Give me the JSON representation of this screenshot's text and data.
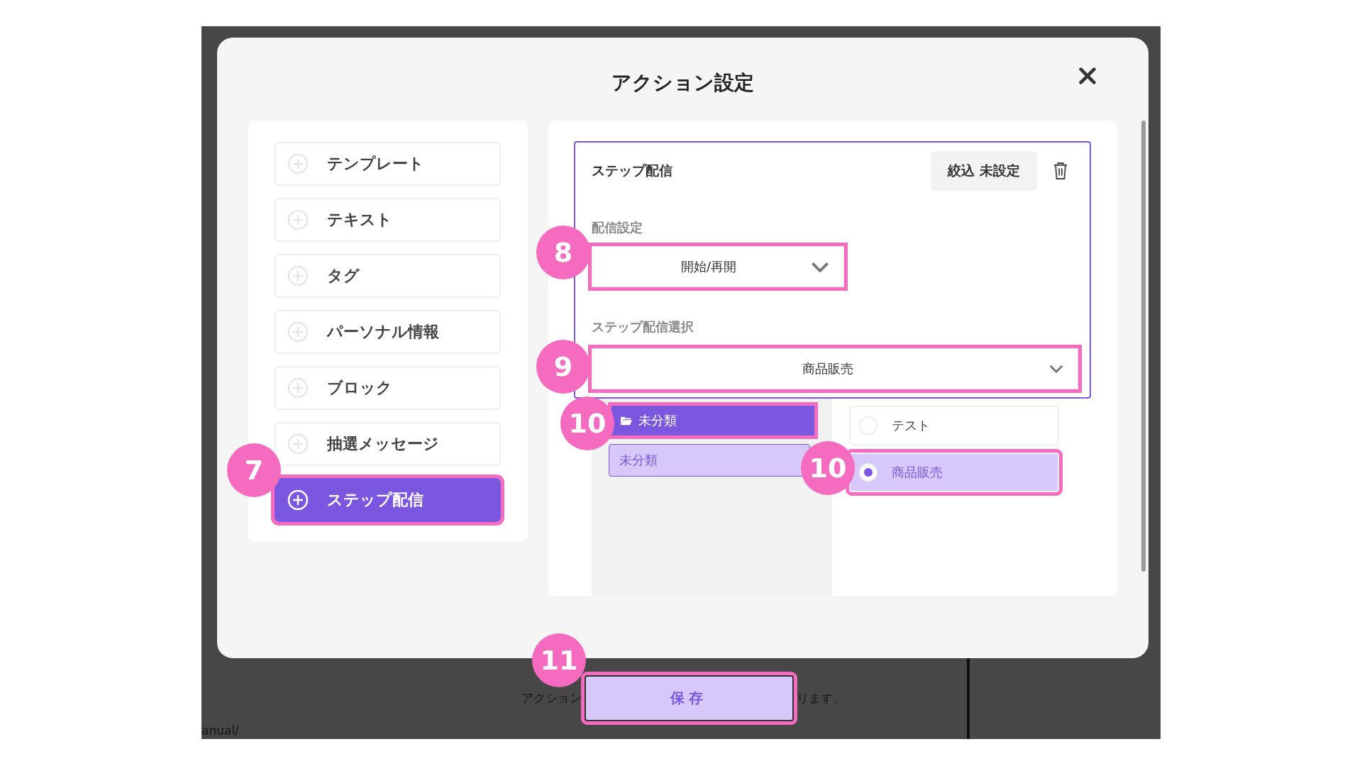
{
  "dialog": {
    "title": "アクション設定"
  },
  "action_types": [
    {
      "label": "テンプレート",
      "selected": false,
      "highlighted": false
    },
    {
      "label": "テキスト",
      "selected": false,
      "highlighted": false
    },
    {
      "label": "タグ",
      "selected": false,
      "highlighted": false
    },
    {
      "label": "パーソナル情報",
      "selected": false,
      "highlighted": false
    },
    {
      "label": "ブロック",
      "selected": false,
      "highlighted": false
    },
    {
      "label": "抽選メッセージ",
      "selected": false,
      "highlighted": false
    },
    {
      "label": "ステップ配信",
      "selected": true,
      "highlighted": true
    }
  ],
  "action_card": {
    "title": "ステップ配信",
    "filter_button": "絞込 未設定",
    "delivery_setting": {
      "label": "配信設定",
      "value": "開始/再開",
      "highlighted": true
    },
    "step_select": {
      "label": "ステップ配信選択",
      "value": "商品販売",
      "highlighted": true
    }
  },
  "folders": [
    {
      "label": "未分類",
      "expanded": true,
      "highlighted": true,
      "children": [
        {
          "label": "未分類",
          "selected": true
        }
      ]
    }
  ],
  "options": [
    {
      "label": "テスト",
      "selected": false,
      "highlighted": false
    },
    {
      "label": "商品販売",
      "selected": true,
      "highlighted": true
    }
  ],
  "save_button": {
    "label": "保存",
    "highlighted": true
  },
  "callouts": [
    "7",
    "8",
    "9",
    "10",
    "10",
    "11"
  ],
  "background_texts": [
    "アクション",
    "ります。",
    "anual/"
  ]
}
